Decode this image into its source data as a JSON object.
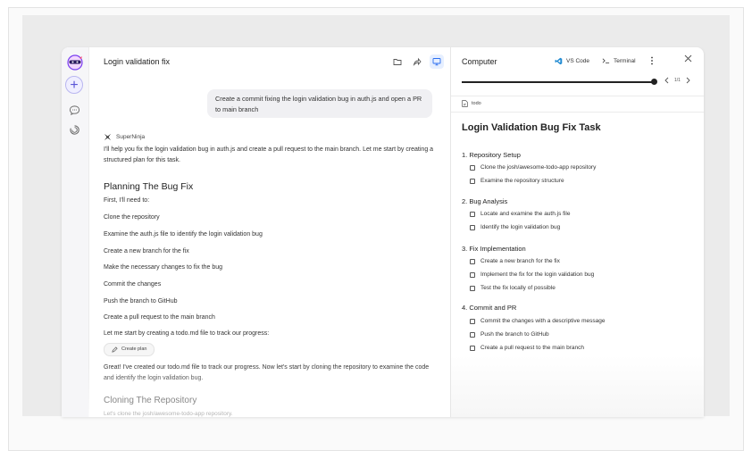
{
  "chat": {
    "title": "Login validation fix",
    "user_message": "Create a commit fixing the login validation bug in auth.js and open a PR to main branch",
    "agent_name": "SuperNinja",
    "intro": "I'll help you fix the login validation bug in auth.js and create a pull request to the main branch. Let me start by creating a structured plan for this task.",
    "plan_heading": "Planning The Bug Fix",
    "steps": [
      "First, I'll need to:",
      "Clone the repository",
      "Examine the auth.js file to identify the login validation bug",
      "Create a new branch for the fix",
      "Make the necessary changes to fix the bug",
      "Commit the changes",
      "Push the branch to GitHub",
      "Create a pull request to the main branch",
      "Let me start by creating a todo.md file to track our progress:"
    ],
    "chip_label": "Create plan",
    "followup": "Great! I've created our todo.md file to track our progress. Now let's start by cloning the repository to examine the code and identify the login validation bug.",
    "clone_heading": "Cloning The Repository",
    "clone_line": "Let's clone the josh/awesome-todo-app repository."
  },
  "computer": {
    "title": "Computer",
    "vscode_label": "VS Code",
    "terminal_label": "Terminal",
    "pager": "1/1",
    "file_tab": "todo",
    "doc_title": "Login Validation Bug Fix Task",
    "sections": [
      {
        "heading": "1. Repository Setup",
        "tasks": [
          "Clone the josh/awesome-todo-app repository",
          "Examine the repository structure"
        ]
      },
      {
        "heading": "2. Bug Analysis",
        "tasks": [
          "Locate and examine the auth.js file",
          "Identify the login validation bug"
        ]
      },
      {
        "heading": "3. Fix Implementation",
        "tasks": [
          "Create a new branch for the fix",
          "Implement the fix for the login validation bug",
          "Test the fix locally of possible"
        ]
      },
      {
        "heading": "4. Commit and PR",
        "tasks": [
          "Commit the changes with a descriptive message",
          "Push the branch to GitHub",
          "Create a pull request to the main branch"
        ]
      }
    ]
  },
  "colors": {
    "accent": "#5a55d6",
    "vscode_blue": "#1f8ad2"
  }
}
